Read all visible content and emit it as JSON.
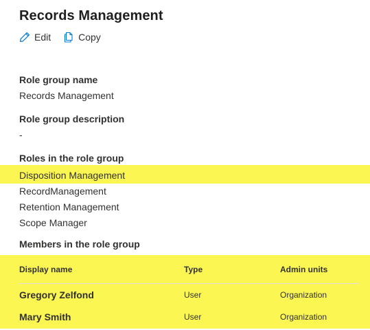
{
  "header": {
    "title": "Records Management"
  },
  "toolbar": {
    "edit_label": "Edit",
    "copy_label": "Copy",
    "accent_color": "#0078d4"
  },
  "role_group_name": {
    "label": "Role group name",
    "value": "Records Management"
  },
  "role_group_description": {
    "label": "Role group description",
    "value": "-"
  },
  "roles": {
    "label": "Roles in the role group",
    "items": [
      "Disposition Management",
      "RecordManagement",
      "Retention Management",
      "Scope Manager"
    ]
  },
  "members": {
    "label": "Members in the role group",
    "columns": [
      "Display name",
      "Type",
      "Admin units"
    ],
    "rows": [
      {
        "display_name": "Gregory Zelfond",
        "type": "User",
        "admin_units": "Organization"
      },
      {
        "display_name": "Mary Smith",
        "type": "User",
        "admin_units": "Organization"
      }
    ]
  },
  "highlight_color": "#fbf652"
}
